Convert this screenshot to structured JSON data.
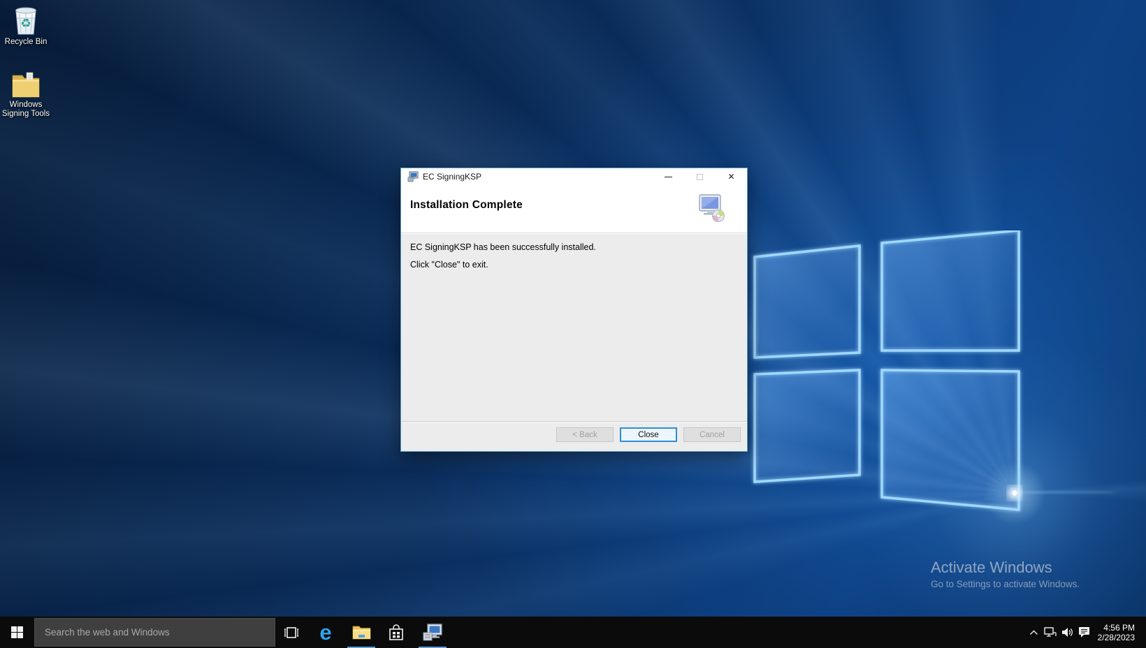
{
  "desktop": {
    "icons": [
      {
        "name": "recycle-bin",
        "label": "Recycle Bin"
      },
      {
        "name": "windows-signing-tools",
        "label": "Windows Signing Tools"
      }
    ],
    "watermark": {
      "title": "Activate Windows",
      "subtitle": "Go to Settings to activate Windows."
    }
  },
  "installer_window": {
    "title": "EC SigningKSP",
    "heading": "Installation Complete",
    "message_line1": "EC SigningKSP has been successfully installed.",
    "message_line2": "Click \"Close\" to exit.",
    "buttons": {
      "back": "< Back",
      "close": "Close",
      "cancel": "Cancel"
    },
    "controls": {
      "close_glyph": "✕"
    }
  },
  "taskbar": {
    "search": {
      "placeholder": "Search the web and Windows"
    },
    "apps": [
      "task-view",
      "microsoft-edge",
      "file-explorer",
      "windows-store",
      "ec-signingksp-installer"
    ],
    "icons": {
      "edge_glyph": "e"
    },
    "tray": {
      "time": "4:56 PM",
      "date": "2/28/2023"
    }
  },
  "colors": {
    "accent": "#0078d7",
    "close_button_border": "#2b8dd8",
    "taskbar_background": "#0b0b0b",
    "dialog_body": "#ececec",
    "open_app_underline": "#5e9dd8",
    "wallpaper_base": "#0a2c5a"
  }
}
